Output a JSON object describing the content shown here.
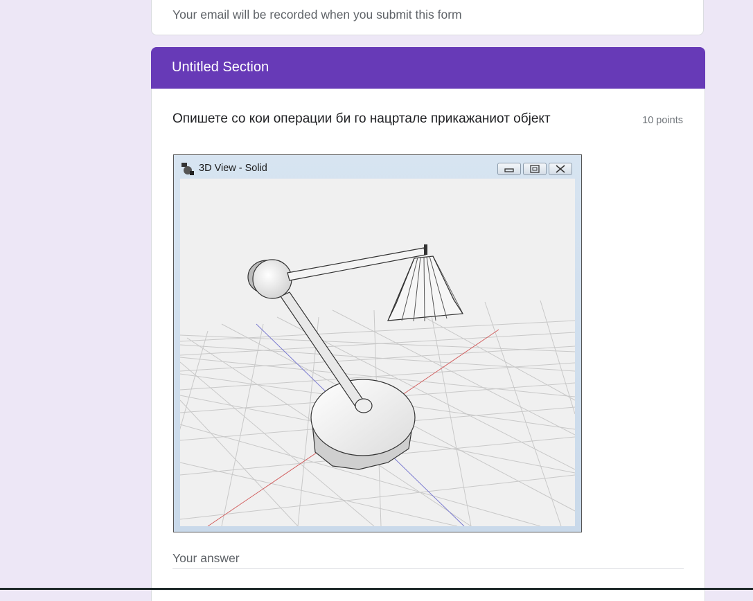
{
  "form": {
    "email_note": "Your email will be recorded when you submit this form"
  },
  "section": {
    "title": "Untitled Section"
  },
  "question": {
    "text": "Опишете со кои операции би го нацртале прикажаниот објект",
    "points": "10 points",
    "answer_placeholder": "Your answer"
  },
  "image_window": {
    "title": "3D View - Solid"
  },
  "colors": {
    "page_bg": "#ede7f6",
    "section_header": "#673ab7",
    "card_bg": "#ffffff",
    "muted_text": "#5f6368"
  }
}
